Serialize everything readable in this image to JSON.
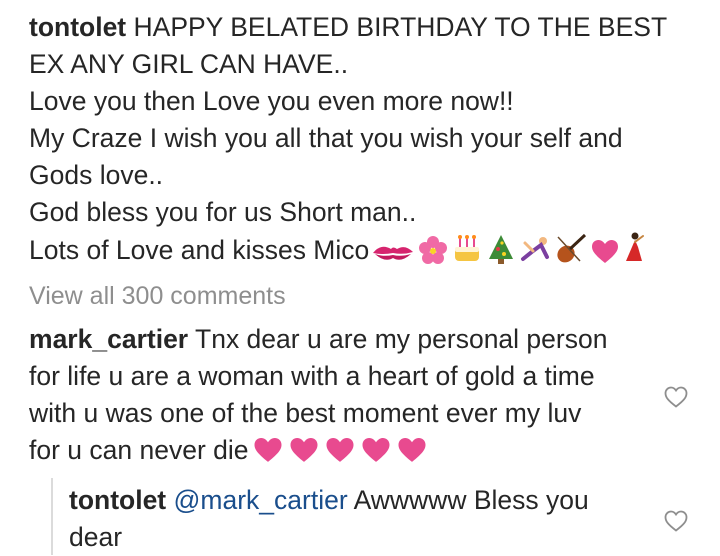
{
  "caption": {
    "username": "tontolet",
    "lines": [
      "HAPPY BELATED BIRTHDAY TO THE BEST",
      "EX ANY GIRL CAN HAVE..",
      "Love you then Love you even more now!!",
      "My Craze I wish you all that you wish your self and",
      "Gods love..",
      "God bless you for us Short man..",
      "Lots of Love and kisses Mico"
    ],
    "emojis": [
      "kiss-mark-icon",
      "cherry-blossom-icon",
      "birthday-cake-icon",
      "christmas-tree-icon",
      "cartwheel-icon",
      "violin-icon",
      "heart-icon",
      "dancer-icon"
    ]
  },
  "view_all": "View all 300 comments",
  "comment": {
    "username": "mark_cartier",
    "lines": [
      "Tnx dear u are my personal person",
      "for life u are a woman with a heart of gold a time",
      "with u was one of the best moment ever my luv",
      "for u can never die"
    ],
    "heart_count": 5,
    "heart_color": "#e84a8f"
  },
  "reply": {
    "username": "tontolet",
    "mention": "@mark_cartier",
    "lines": [
      "Awwwww Bless you",
      "dear"
    ]
  },
  "colors": {
    "text": "#262626",
    "muted": "#8e8e8e",
    "link": "#1a4e8c",
    "heart": "#e84a8f"
  }
}
